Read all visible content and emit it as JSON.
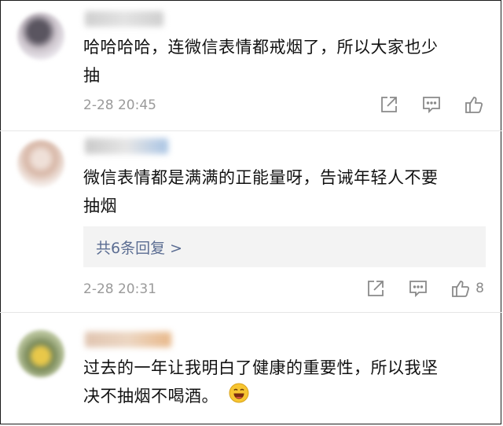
{
  "comments": [
    {
      "text_line1": "哈哈哈哈，连微信表情都戒烟了，所以大家也少",
      "text_line2": "抽",
      "time": "2-28 20:45",
      "like_count": ""
    },
    {
      "text_line1": "微信表情都是满满的正能量呀，告诫年轻人不要",
      "text_line2": "抽烟",
      "time": "2-28 20:31",
      "like_count": "8",
      "replies_label": "共6条回复 >"
    },
    {
      "text_line1": "过去的一年让我明白了健康的重要性，所以我坚",
      "text_line2": "决不抽烟不喝酒。",
      "emoji": "laughing-face-emoji"
    }
  ],
  "colors": {
    "text": "#111111",
    "meta": "#9a9a9a",
    "reply_link": "#5b6d92",
    "reply_bg": "#f3f3f3"
  }
}
